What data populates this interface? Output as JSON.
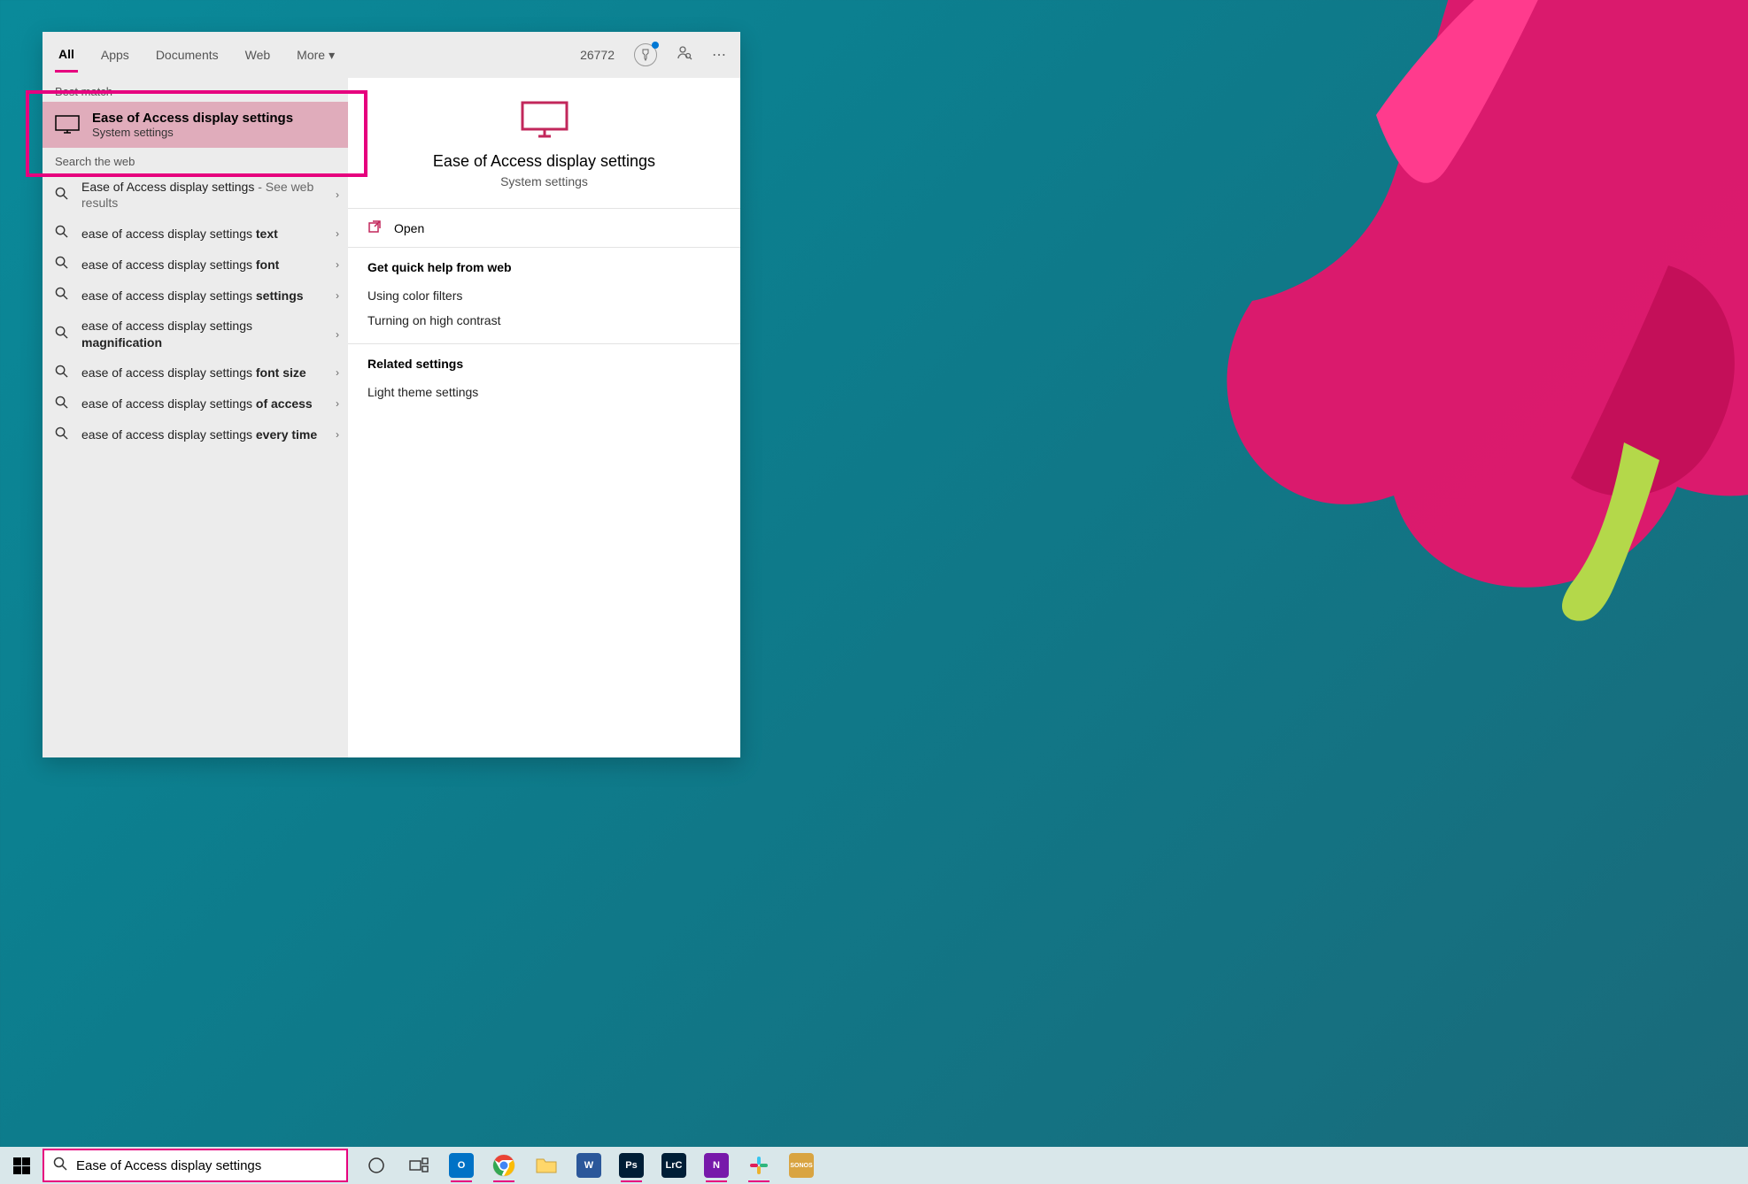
{
  "tabs": {
    "all": "All",
    "apps": "Apps",
    "documents": "Documents",
    "web": "Web",
    "more": "More"
  },
  "header": {
    "reward_points": "26772"
  },
  "sections": {
    "best_match": "Best match",
    "search_web": "Search the web"
  },
  "best_match": {
    "title": "Ease of Access display settings",
    "subtitle": "System settings"
  },
  "web_results": [
    {
      "prefix": "Ease of Access display settings",
      "bold": "",
      "suffix": " - See web results"
    },
    {
      "prefix": "ease of access display settings ",
      "bold": "text",
      "suffix": ""
    },
    {
      "prefix": "ease of access display settings ",
      "bold": "font",
      "suffix": ""
    },
    {
      "prefix": "ease of access display settings ",
      "bold": "settings",
      "suffix": ""
    },
    {
      "prefix": "ease of access display settings ",
      "bold": "magnification",
      "suffix": ""
    },
    {
      "prefix": "ease of access display settings ",
      "bold": "font size",
      "suffix": ""
    },
    {
      "prefix": "ease of access display settings ",
      "bold": "of access",
      "suffix": ""
    },
    {
      "prefix": "ease of access display settings ",
      "bold": "every time",
      "suffix": ""
    }
  ],
  "detail": {
    "title": "Ease of Access display settings",
    "subtitle": "System settings",
    "open": "Open",
    "quick_help_title": "Get quick help from web",
    "quick_help": [
      "Using color filters",
      "Turning on high contrast"
    ],
    "related_title": "Related settings",
    "related": [
      "Light theme settings"
    ]
  },
  "taskbar": {
    "search_value": "Ease of Access display settings",
    "apps": [
      {
        "name": "cortana",
        "label": "",
        "bg": "transparent",
        "icon": "circle"
      },
      {
        "name": "task-view",
        "label": "",
        "bg": "transparent",
        "icon": "taskview"
      },
      {
        "name": "outlook",
        "label": "O",
        "bg": "#0072c6",
        "active": true
      },
      {
        "name": "chrome",
        "label": "",
        "bg": "transparent",
        "icon": "chrome",
        "active": true
      },
      {
        "name": "file-explorer",
        "label": "",
        "bg": "transparent",
        "icon": "folder"
      },
      {
        "name": "word",
        "label": "W",
        "bg": "#2b579a"
      },
      {
        "name": "photoshop",
        "label": "Ps",
        "bg": "#001e36",
        "active": true
      },
      {
        "name": "lightroom",
        "label": "LrC",
        "bg": "#001e36"
      },
      {
        "name": "onenote",
        "label": "N",
        "bg": "#7719aa",
        "active": true
      },
      {
        "name": "slack",
        "label": "",
        "bg": "transparent",
        "icon": "slack",
        "active": true
      },
      {
        "name": "sonos",
        "label": "SONOS",
        "bg": "#d9a441"
      }
    ]
  }
}
